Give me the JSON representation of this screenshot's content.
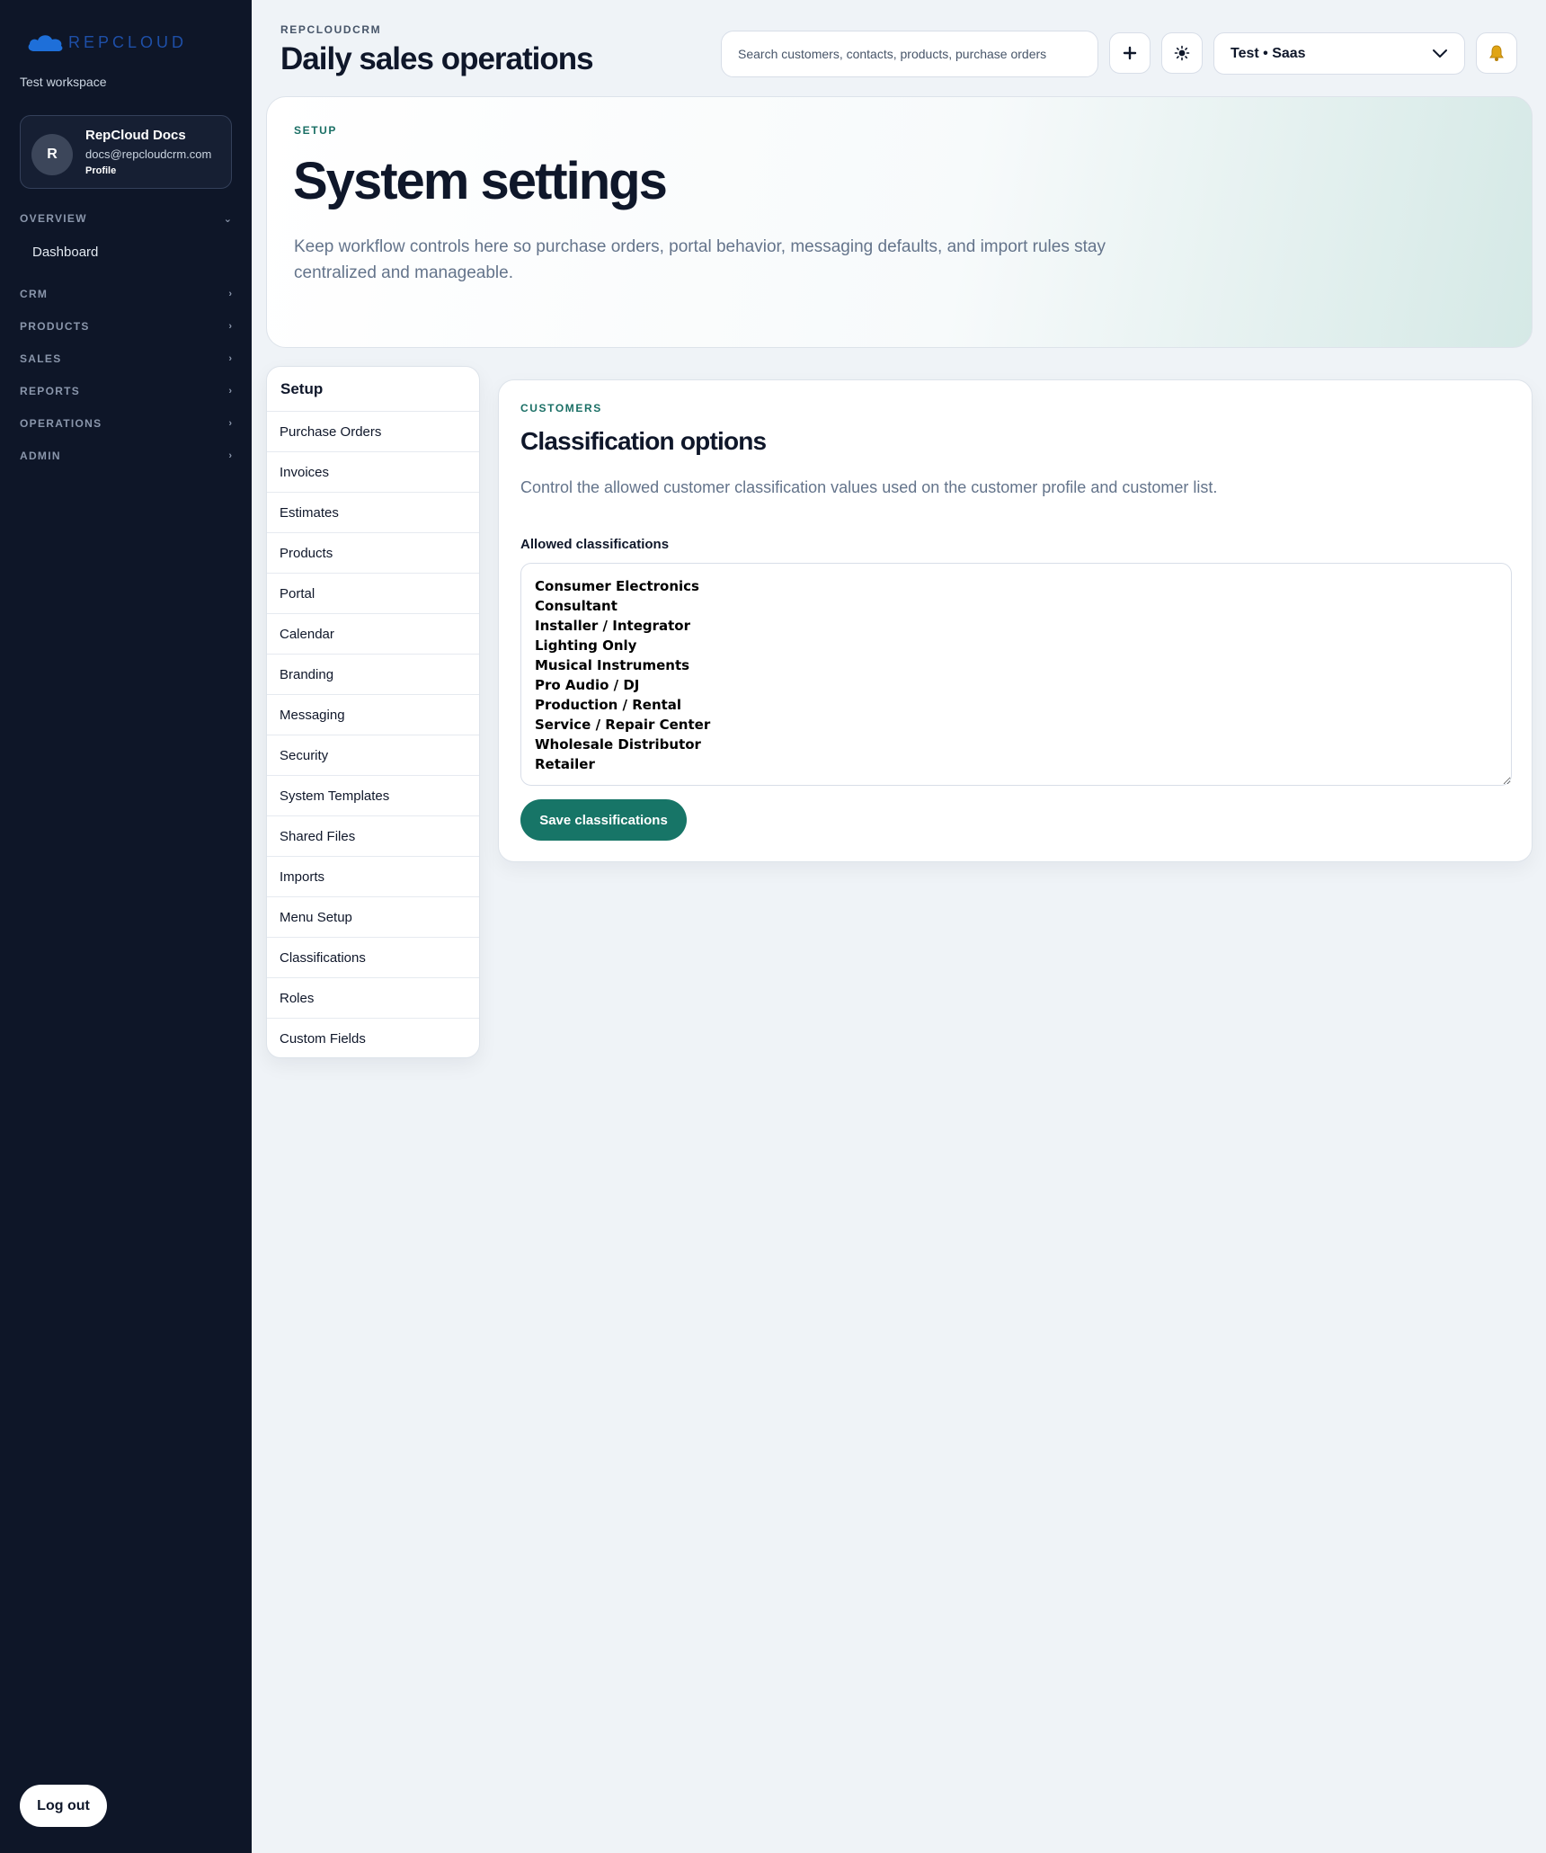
{
  "sidebar": {
    "brand": "REPCLOUD",
    "workspace": "Test workspace",
    "profile": {
      "initial": "R",
      "name": "RepCloud Docs",
      "email": "docs@repcloudcrm.com",
      "link": "Profile"
    },
    "groups": [
      {
        "label": "OVERVIEW",
        "chevron": "⌄",
        "items": [
          {
            "label": "Dashboard"
          }
        ]
      },
      {
        "label": "CRM",
        "chevron": "›"
      },
      {
        "label": "PRODUCTS",
        "chevron": "›"
      },
      {
        "label": "SALES",
        "chevron": "›"
      },
      {
        "label": "REPORTS",
        "chevron": "›"
      },
      {
        "label": "OPERATIONS",
        "chevron": "›"
      },
      {
        "label": "ADMIN",
        "chevron": "›"
      }
    ],
    "logout_label": "Log out"
  },
  "header": {
    "eyebrow": "REPCLOUDCRM",
    "title": "Daily sales operations",
    "search_placeholder": "Search customers, contacts, products, purchase orders",
    "tenant": "Test • Saas",
    "icons": [
      "plus-icon",
      "sun-icon",
      "chevron-down-icon",
      "bell-icon"
    ]
  },
  "hero": {
    "eyebrow": "SETUP",
    "title": "System settings",
    "description": "Keep workflow controls here so purchase orders, portal behavior, messaging defaults, and import rules stay centralized and manageable."
  },
  "setup_nav": {
    "title": "Setup",
    "items": [
      "Purchase Orders",
      "Invoices",
      "Estimates",
      "Products",
      "Portal",
      "Calendar",
      "Branding",
      "Messaging",
      "Security",
      "System Templates",
      "Shared Files",
      "Imports",
      "Menu Setup",
      "Classifications",
      "Roles",
      "Custom Fields"
    ]
  },
  "classification": {
    "eyebrow": "CUSTOMERS",
    "title": "Classification options",
    "description": "Control the allowed customer classification values used on the customer profile and customer list.",
    "field_label": "Allowed classifications",
    "values": [
      "Consumer Electronics",
      "Consultant",
      "Installer / Integrator",
      "Lighting Only",
      "Musical Instruments",
      "Pro Audio / DJ",
      "Production / Rental",
      "Service / Repair Center",
      "Wholesale Distributor",
      "Retailer"
    ],
    "save_label": "Save classifications"
  },
  "colors": {
    "sidebar_bg": "#0e1628",
    "accent": "#177567",
    "eyebrow_teal": "#1a6f65",
    "brand_blue": "#1e6fd9",
    "page_bg": "#eff3f7"
  }
}
